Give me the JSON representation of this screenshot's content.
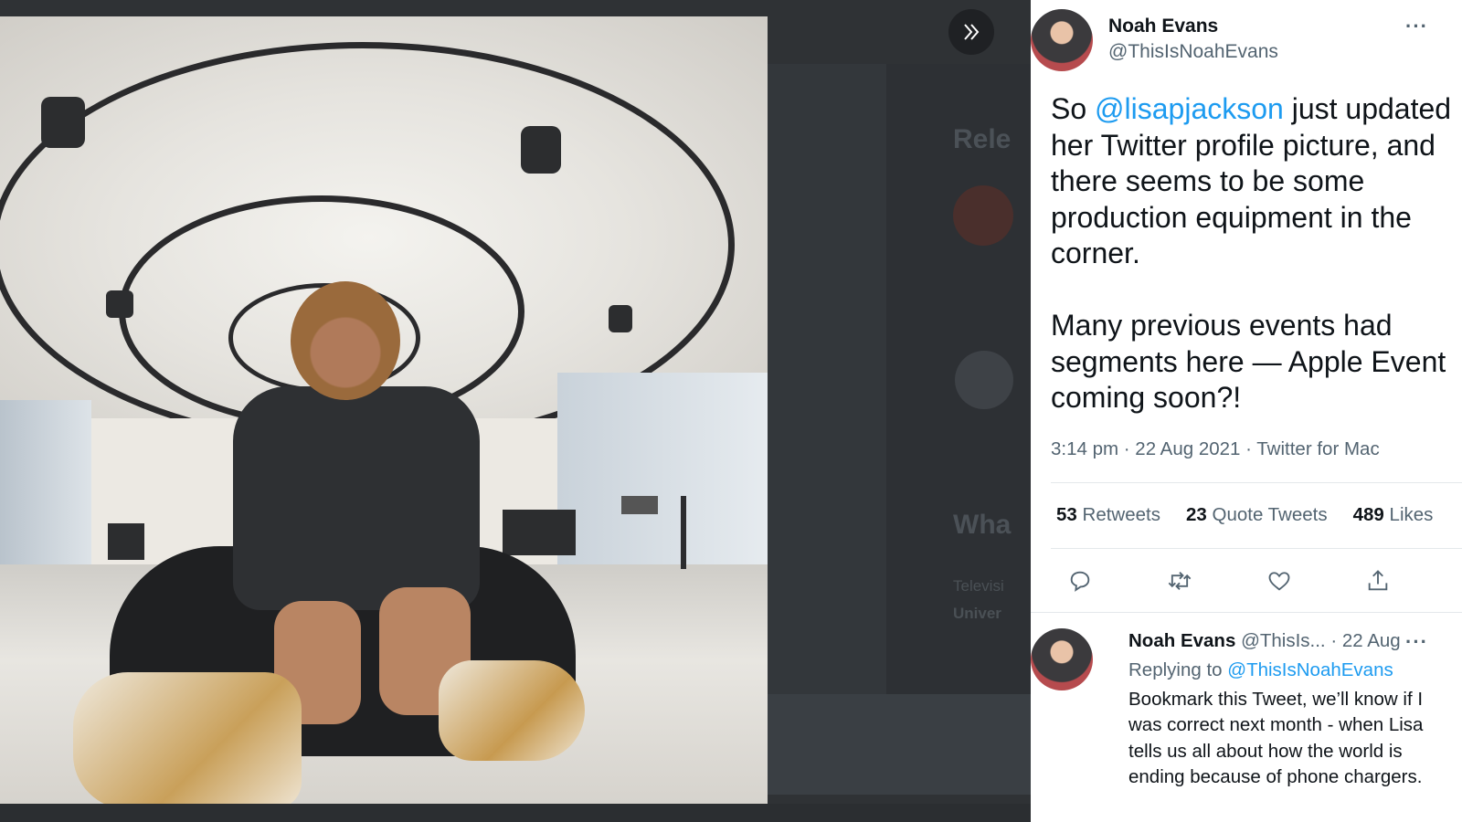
{
  "background": {
    "ghost_heading_1": "Rele",
    "ghost_heading_2": "Wha",
    "ghost_small_1": "Televisi",
    "ghost_small_2": "Univer"
  },
  "viewer": {
    "expand_icon": "double-chevron-right-icon"
  },
  "tweet": {
    "author_name": "Noah Evans",
    "author_handle": "@ThisIsNoahEvans",
    "more_label": "···",
    "text_before": "So ",
    "mention": "@lisapjackson",
    "text_after": " just updated her Twitter profile picture, and there seems to be some production equipment in the corner.\n\nMany previous events had segments here — Apple Event coming soon?!",
    "meta": "3:14 pm · 22 Aug 2021 · Twitter for Mac",
    "retweets_count": "53",
    "retweets_label": "Retweets",
    "quotes_count": "23",
    "quotes_label": "Quote Tweets",
    "likes_count": "489",
    "likes_label": "Likes",
    "actions": [
      "reply-icon",
      "retweet-icon",
      "like-icon",
      "share-icon"
    ]
  },
  "reply": {
    "author_name": "Noah Evans",
    "author_handle_truncated": "@ThisIs...",
    "date": "· 22 Aug",
    "more_label": "···",
    "replying_label": "Replying to",
    "replying_handle": "@ThisIsNoahEvans",
    "text": "Bookmark this Tweet, we’ll know if I was correct next month - when Lisa tells us all about how the world is ending because of phone chargers."
  },
  "colors": {
    "accent": "#1d9bf0",
    "secondary_text": "#536471",
    "primary_text": "#0f1419"
  }
}
